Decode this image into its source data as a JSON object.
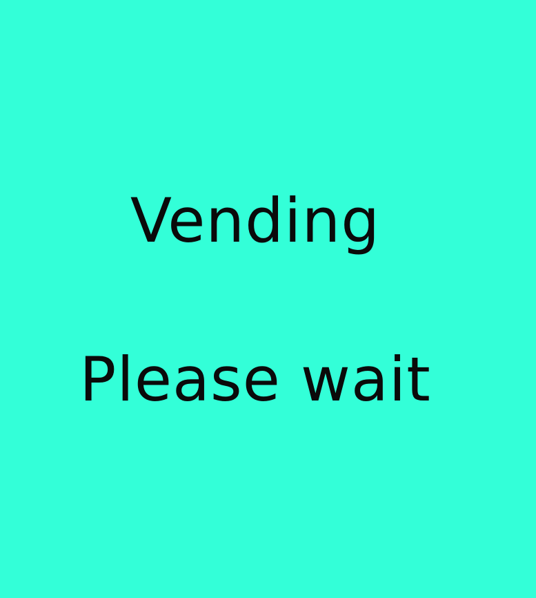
{
  "screen": {
    "background_color": "#33ffd8",
    "text_color": "#0a0a0a",
    "status_title": "Vending",
    "status_message": "Please wait"
  }
}
